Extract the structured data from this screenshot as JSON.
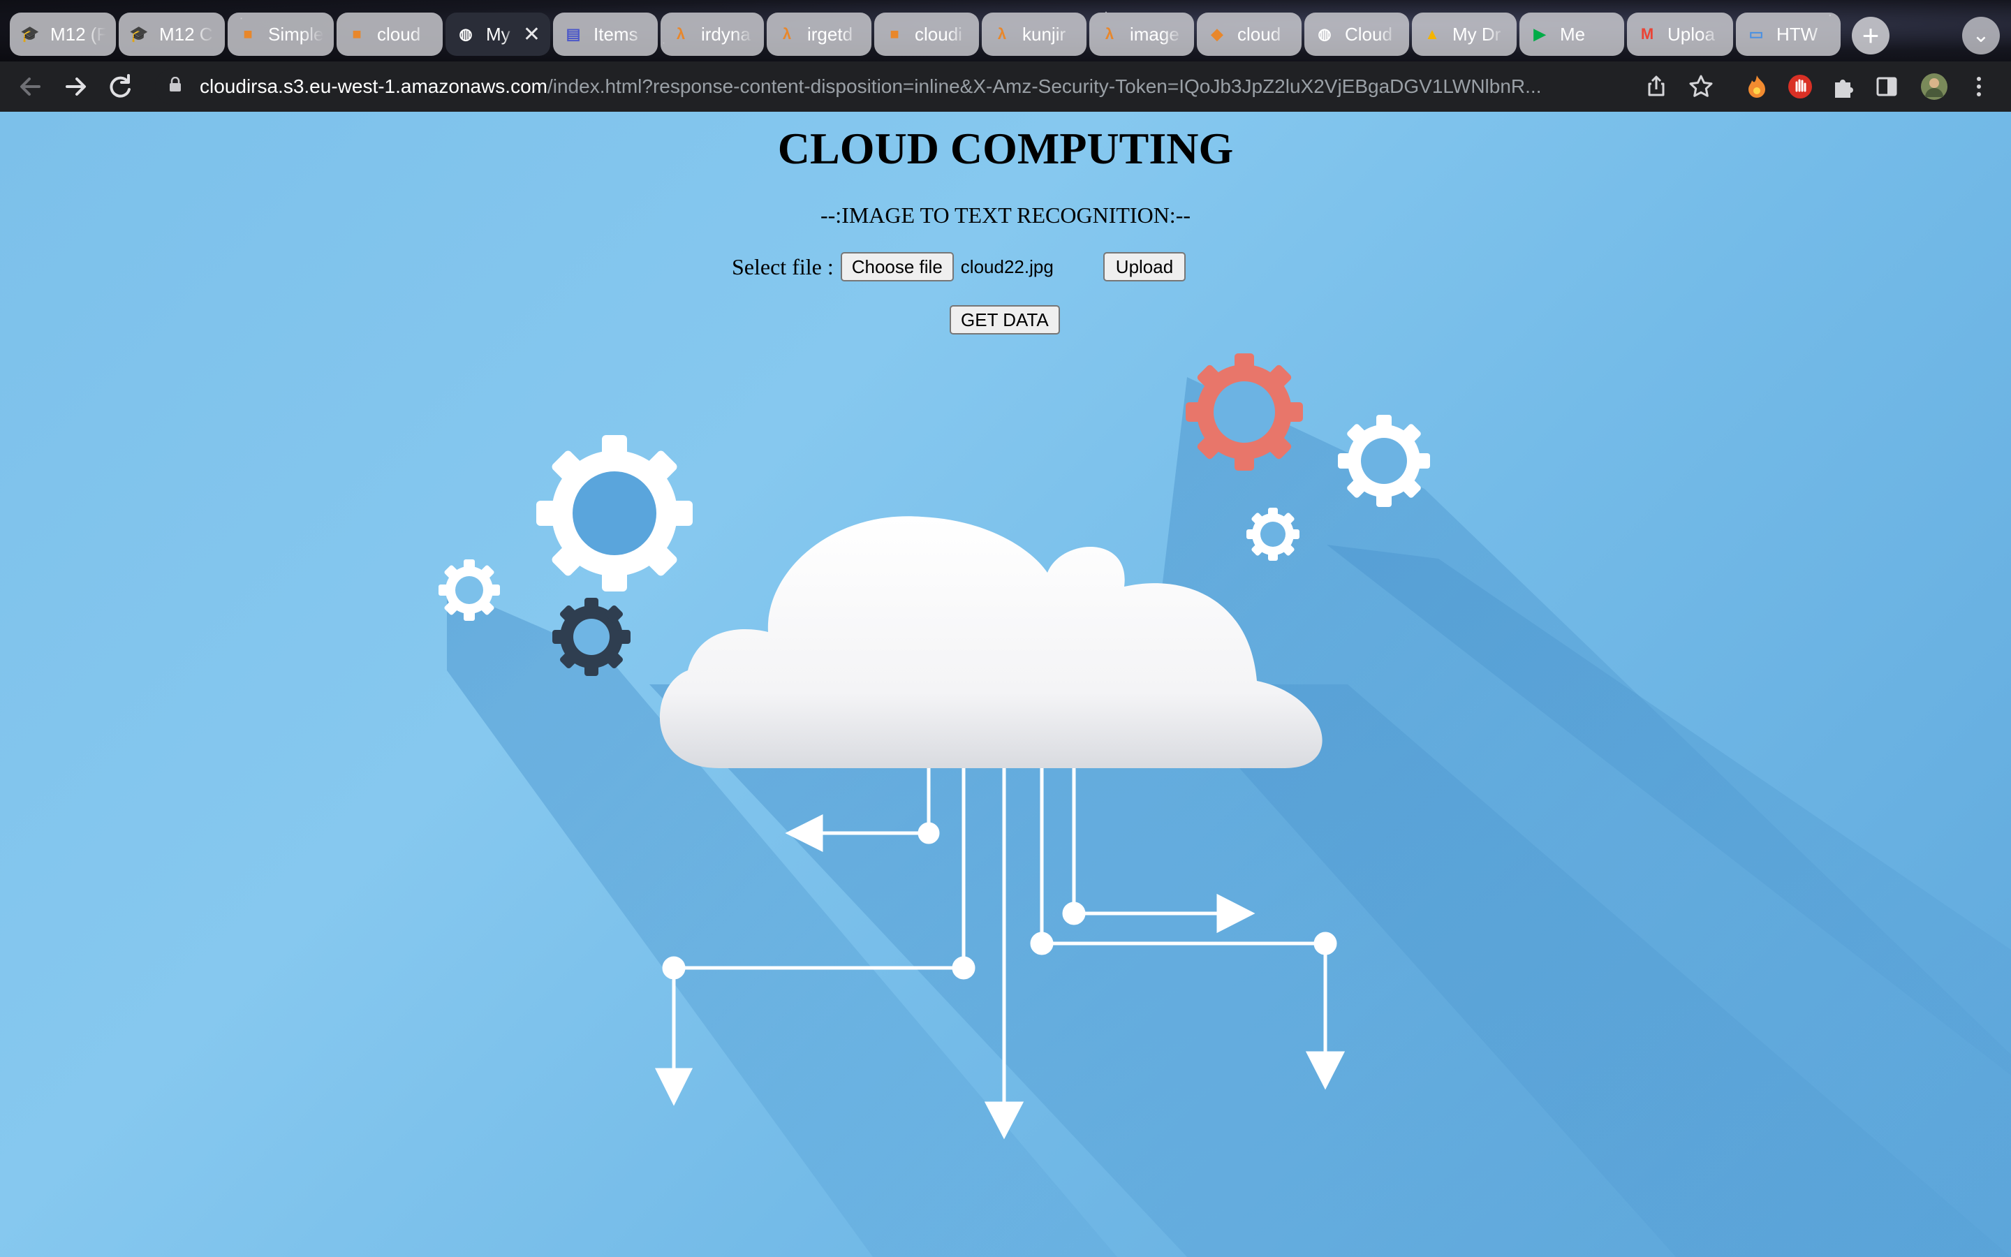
{
  "browser": {
    "tabs": [
      {
        "label": "M12 (F",
        "icon": "graduation-cap-icon",
        "color": "#8a6d4b"
      },
      {
        "label": "M12 C",
        "icon": "graduation-cap-icon",
        "color": "#8a6d4b"
      },
      {
        "label": "Simple",
        "icon": "aws-cube-icon",
        "color": "#e8872b"
      },
      {
        "label": "cloud",
        "icon": "aws-cube-icon",
        "color": "#e8872b"
      },
      {
        "label": "My",
        "icon": "globe-icon",
        "color": "#ffffff",
        "active": true
      },
      {
        "label": "Items",
        "icon": "dynamodb-icon",
        "color": "#4b57c9"
      },
      {
        "label": "irdyna",
        "icon": "lambda-icon",
        "color": "#e8872b"
      },
      {
        "label": "irgetd",
        "icon": "lambda-icon",
        "color": "#e8872b"
      },
      {
        "label": "cloudi",
        "icon": "aws-cube-icon",
        "color": "#e8872b"
      },
      {
        "label": "kunjir",
        "icon": "lambda-icon",
        "color": "#e8872b"
      },
      {
        "label": "image",
        "icon": "lambda-icon",
        "color": "#e8872b"
      },
      {
        "label": "cloud",
        "icon": "aws-stack-icon",
        "color": "#e8872b"
      },
      {
        "label": "Cloud",
        "icon": "globe-icon",
        "color": "#ffffff"
      },
      {
        "label": "My Dr",
        "icon": "google-drive-icon",
        "color": "#f4b400"
      },
      {
        "label": "Me",
        "icon": "google-meet-icon",
        "color": "#00ac47"
      },
      {
        "label": "Uploa",
        "icon": "gmail-icon",
        "color": "#ea4335"
      },
      {
        "label": "HTW",
        "icon": "laptop-icon",
        "color": "#4a90e2"
      }
    ],
    "close_glyph": "✕",
    "new_tab_glyph": "+",
    "tab_menu_glyph": "⌄",
    "url_host": "cloudirsa.s3.eu-west-1.amazonaws.com",
    "url_rest": "/index.html?response-content-disposition=inline&X-Amz-Security-Token=IQoJb3JpZ2luX2VjEBgaDGV1LWNlbnR..."
  },
  "page": {
    "title": "CLOUD COMPUTING",
    "subtitle": "--:IMAGE TO TEXT RECOGNITION:--",
    "select_label": "Select file :",
    "choose_button": "Choose file",
    "file_name": "cloud22.jpg",
    "upload_button": "Upload",
    "get_data_button": "GET DATA"
  },
  "colors": {
    "page_bg": "#7cc0ea",
    "gear_white": "#ffffff",
    "gear_red": "#e8766a",
    "gear_dark": "#2f3e50"
  }
}
